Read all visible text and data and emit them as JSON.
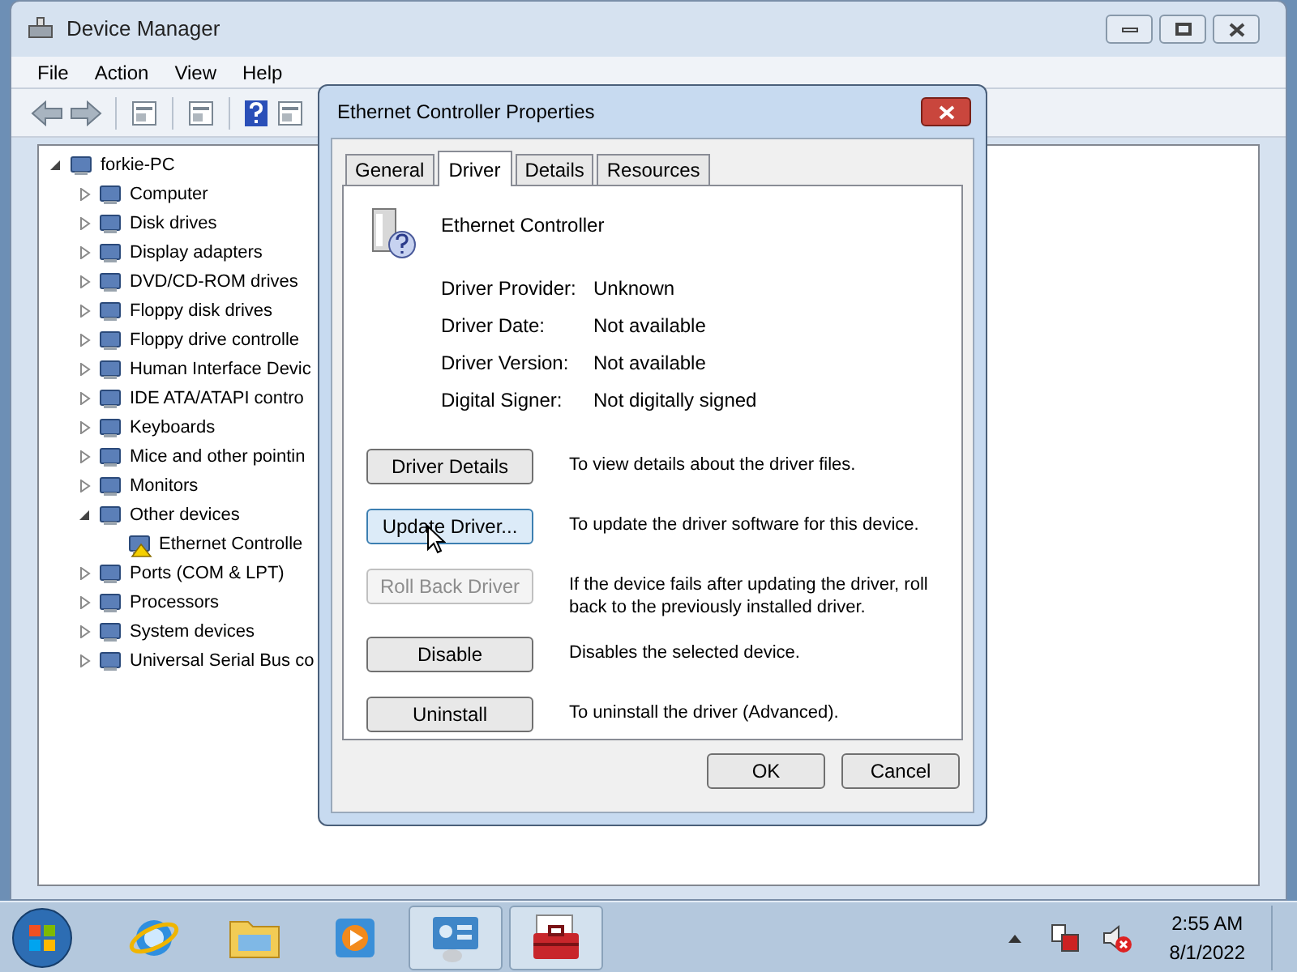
{
  "window": {
    "title": "Device Manager"
  },
  "menu": [
    "File",
    "Action",
    "View",
    "Help"
  ],
  "tree": {
    "label": "forkie-PC",
    "expanded": true,
    "children": [
      {
        "label": "Computer",
        "expanded": false
      },
      {
        "label": "Disk drives",
        "expanded": false
      },
      {
        "label": "Display adapters",
        "expanded": false
      },
      {
        "label": "DVD/CD-ROM drives",
        "expanded": false
      },
      {
        "label": "Floppy disk drives",
        "expanded": false
      },
      {
        "label": "Floppy drive controlle",
        "expanded": false
      },
      {
        "label": "Human Interface Devic",
        "expanded": false
      },
      {
        "label": "IDE ATA/ATAPI contro",
        "expanded": false
      },
      {
        "label": "Keyboards",
        "expanded": false
      },
      {
        "label": "Mice and other pointin",
        "expanded": false
      },
      {
        "label": "Monitors",
        "expanded": false
      },
      {
        "label": "Other devices",
        "expanded": true,
        "children": [
          {
            "label": "Ethernet Controlle",
            "warning": true
          }
        ]
      },
      {
        "label": "Ports (COM & LPT)",
        "expanded": false
      },
      {
        "label": "Processors",
        "expanded": false
      },
      {
        "label": "System devices",
        "expanded": false
      },
      {
        "label": "Universal Serial Bus co",
        "expanded": false
      }
    ]
  },
  "dialog": {
    "title": "Ethernet Controller Properties",
    "tabs": [
      {
        "label": "General",
        "selected": false
      },
      {
        "label": "Driver",
        "selected": true
      },
      {
        "label": "Details",
        "selected": false
      },
      {
        "label": "Resources",
        "selected": false
      }
    ],
    "device_name": "Ethernet Controller",
    "properties": [
      {
        "label": "Driver Provider:",
        "value": "Unknown"
      },
      {
        "label": "Driver Date:",
        "value": "Not available"
      },
      {
        "label": "Driver Version:",
        "value": "Not available"
      },
      {
        "label": "Digital Signer:",
        "value": "Not digitally signed"
      }
    ],
    "actions": [
      {
        "label": "Driver Details",
        "description": "To view details about the driver files.",
        "disabled": false,
        "hovered": false
      },
      {
        "label": "Update Driver...",
        "description": "To update the driver software for this device.",
        "disabled": false,
        "hovered": true
      },
      {
        "label": "Roll Back Driver",
        "description": "If the device fails after updating the driver, roll back to the previously installed driver.",
        "disabled": true,
        "hovered": false
      },
      {
        "label": "Disable",
        "description": "Disables the selected device.",
        "disabled": false,
        "hovered": false
      },
      {
        "label": "Uninstall",
        "description": "To uninstall the driver (Advanced).",
        "disabled": false,
        "hovered": false
      }
    ],
    "buttons": [
      "OK",
      "Cancel"
    ]
  },
  "taskbar": {
    "apps": [
      {
        "kind": "browser",
        "selected": false
      },
      {
        "kind": "folder",
        "selected": false
      },
      {
        "kind": "media",
        "selected": false
      },
      {
        "kind": "devices",
        "selected": true
      },
      {
        "kind": "toolbox",
        "selected": true
      }
    ],
    "time": "2:55 AM",
    "date": "8/1/2022"
  }
}
